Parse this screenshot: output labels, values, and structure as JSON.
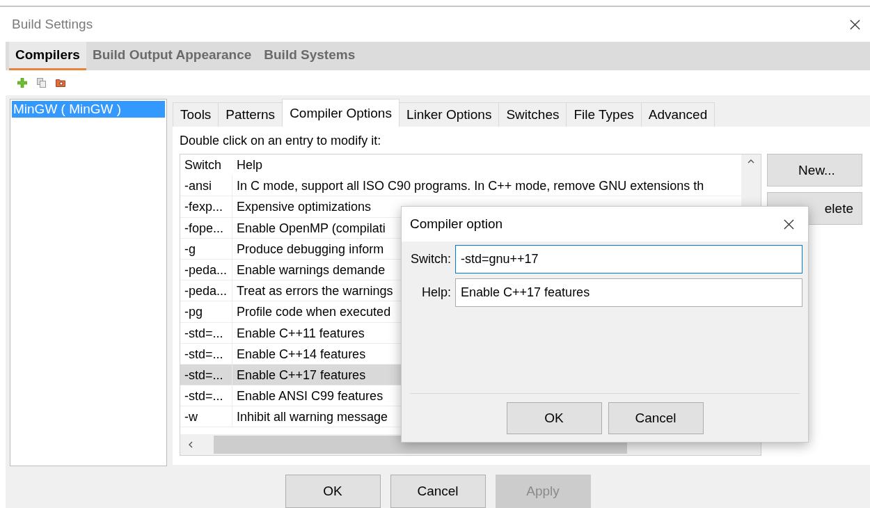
{
  "window": {
    "title": "Build Settings"
  },
  "top_tabs": [
    {
      "label": "Compilers",
      "selected": true
    },
    {
      "label": "Build Output Appearance",
      "selected": false
    },
    {
      "label": "Build Systems",
      "selected": false
    }
  ],
  "toolbar": [
    {
      "kind": "add"
    },
    {
      "kind": "copy"
    },
    {
      "kind": "remove"
    }
  ],
  "compilers": [
    {
      "label": "MinGW ( MinGW )",
      "selected": true
    }
  ],
  "tabs": [
    {
      "label": "Tools",
      "selected": false
    },
    {
      "label": "Patterns",
      "selected": false
    },
    {
      "label": "Compiler Options",
      "selected": true
    },
    {
      "label": "Linker Options",
      "selected": false
    },
    {
      "label": "Switches",
      "selected": false
    },
    {
      "label": "File Types",
      "selected": false
    },
    {
      "label": "Advanced",
      "selected": false
    }
  ],
  "hint": "Double click on an entry to modify it:",
  "table": {
    "columns": [
      "Switch",
      "Help"
    ],
    "rows": [
      {
        "switch": "-ansi",
        "help": "In C mode, support all ISO C90 programs. In C++ mode, remove GNU extensions th",
        "selected": false
      },
      {
        "switch": "-fexp...",
        "help": "Expensive optimizations",
        "selected": false
      },
      {
        "switch": "-fope...",
        "help": "Enable OpenMP (compilati",
        "selected": false
      },
      {
        "switch": "-g",
        "help": "Produce debugging inform",
        "selected": false
      },
      {
        "switch": "-peda...",
        "help": "Enable warnings demande",
        "selected": false
      },
      {
        "switch": "-peda...",
        "help": "Treat as errors the warnings",
        "selected": false
      },
      {
        "switch": "-pg",
        "help": "Profile code when executed",
        "selected": false
      },
      {
        "switch": "-std=...",
        "help": "Enable C++11 features",
        "selected": false
      },
      {
        "switch": "-std=...",
        "help": "Enable C++14 features",
        "selected": false
      },
      {
        "switch": "-std=...",
        "help": "Enable C++17 features",
        "selected": true
      },
      {
        "switch": "-std=...",
        "help": "Enable ANSI C99 features",
        "selected": false
      },
      {
        "switch": "-w",
        "help": "Inhibit all warning message",
        "selected": false
      }
    ]
  },
  "side_buttons": [
    "New...",
    "elete"
  ],
  "dialog": {
    "title": "Compiler option",
    "fields": [
      {
        "label": "Switch:",
        "value": "-std=gnu++17",
        "focused": true
      },
      {
        "label": "Help:",
        "value": "Enable C++17 features",
        "focused": false
      }
    ],
    "buttons": [
      "OK",
      "Cancel"
    ]
  },
  "buttons": [
    {
      "label": "OK",
      "disabled": false
    },
    {
      "label": "Cancel",
      "disabled": false
    },
    {
      "label": "Apply",
      "disabled": true
    }
  ]
}
